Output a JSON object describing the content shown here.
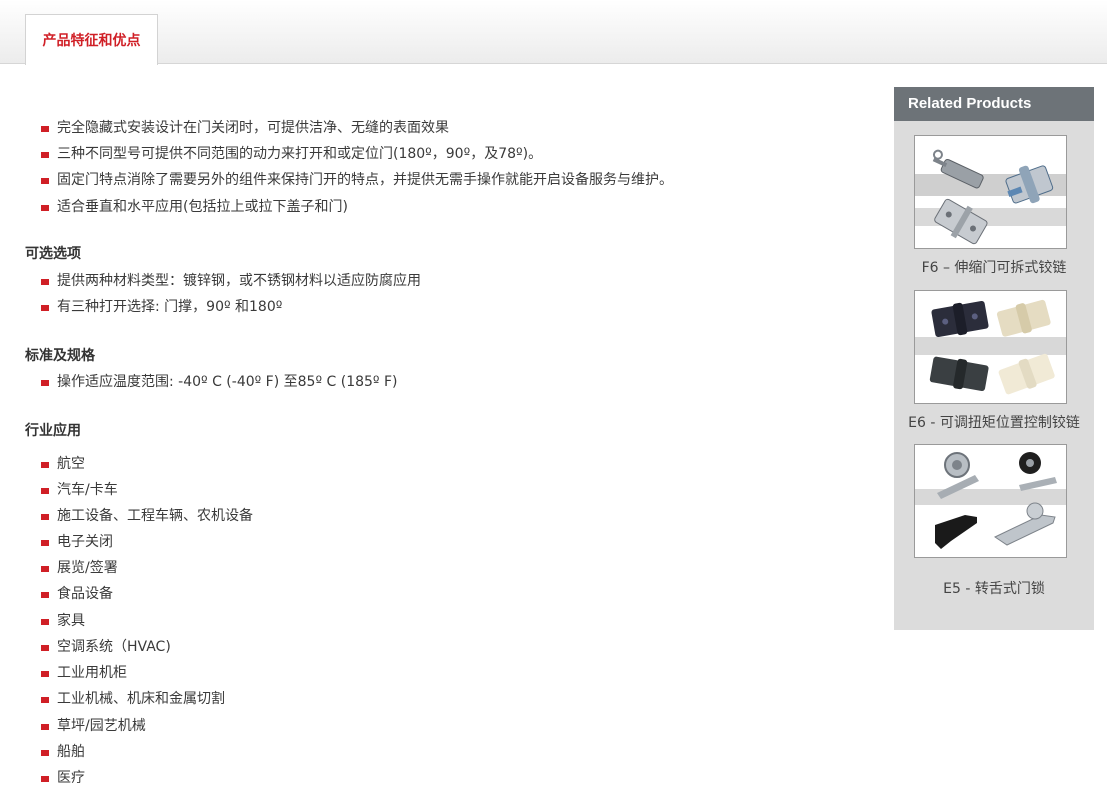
{
  "tab": {
    "label": "产品特征和优点"
  },
  "features": [
    "完全隐藏式安装设计在门关闭时，可提供洁净、无缝的表面效果",
    "三种不同型号可提供不同范围的动力来打开和或定位门(180º，90º，及78º)。",
    "固定门特点消除了需要另外的组件来保持门开的特点，并提供无需手操作就能开启设备服务与维护。",
    "适合垂直和水平应用(包括拉上或拉下盖子和门)"
  ],
  "options": {
    "heading": "可选选项",
    "items": [
      "提供两种材料类型：镀锌钢，或不锈钢材料以适应防腐应用",
      "有三种打开选择: 门撑，90º 和180º"
    ]
  },
  "standards": {
    "heading": "标准及规格",
    "items": [
      "操作适应温度范围: -40º C (-40º F) 至85º C (185º F)"
    ]
  },
  "industries": {
    "heading": "行业应用",
    "items": [
      "航空",
      "汽车/卡车",
      "施工设备、工程车辆、农机设备",
      "电子关闭",
      "展览/签署",
      "食品设备",
      "家具",
      "空调系统（HVAC)",
      "工业用机柜",
      "工业机械、机床和金属切割",
      "草坪/园艺机械",
      "船舶",
      "医疗"
    ]
  },
  "sidebar": {
    "title": "Related Products",
    "products": [
      {
        "label": "F6 – 伸缩门可拆式铰链",
        "image_icon": "hinge-product-icon"
      },
      {
        "label": "E6 - 可调扭矩位置控制铰链",
        "image_icon": "torque-hinge-product-icon"
      },
      {
        "label": "E5 - 转舌式门锁",
        "image_icon": "quarter-turn-latch-product-icon"
      }
    ]
  },
  "colors": {
    "accent": "#d01f26",
    "sidebar_header": "#6d7378",
    "sidebar_bg": "#dcdcdc"
  }
}
